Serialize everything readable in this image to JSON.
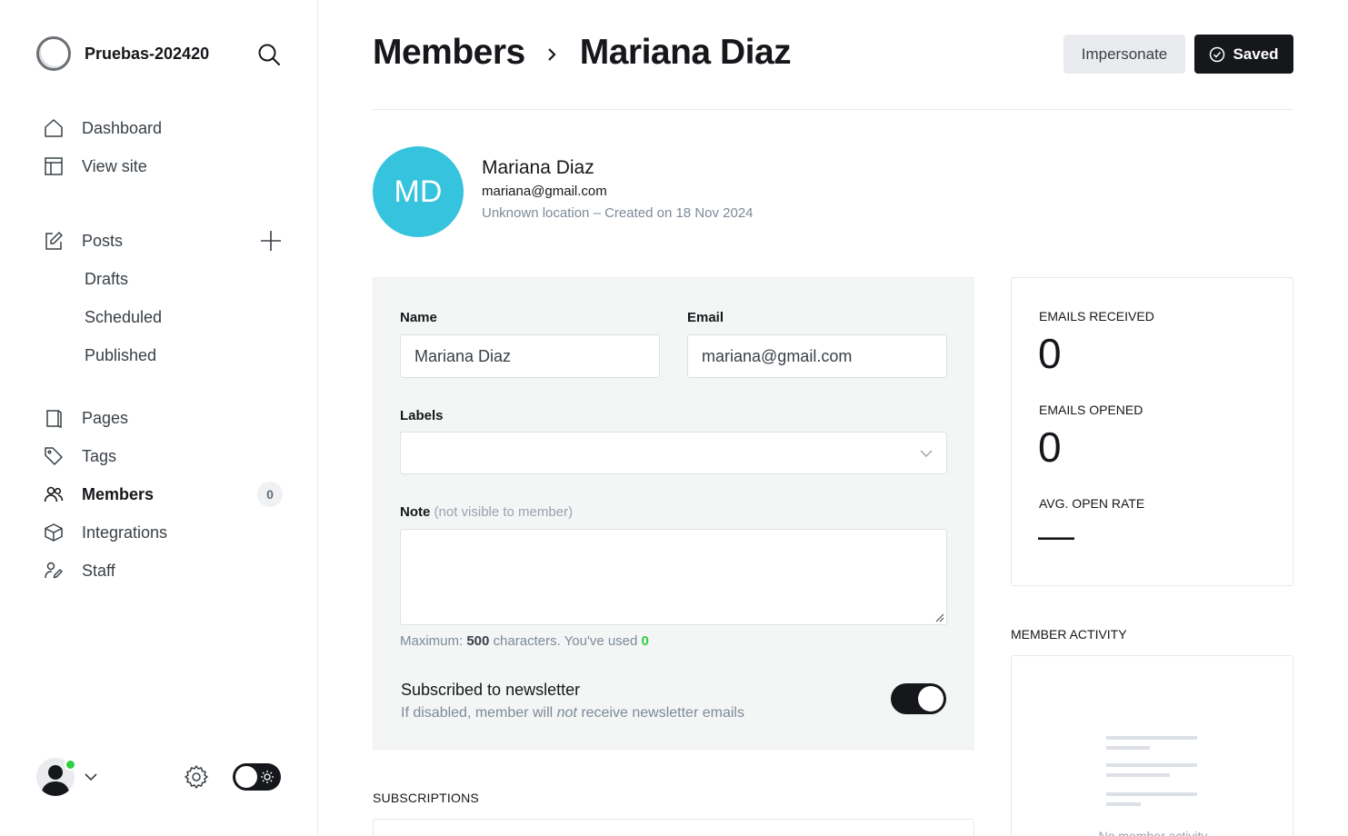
{
  "sidebar": {
    "site_name": "Pruebas-202420",
    "nav": [
      {
        "label": "Dashboard"
      },
      {
        "label": "View site"
      },
      {
        "label": "Posts"
      },
      {
        "label": "Drafts"
      },
      {
        "label": "Scheduled"
      },
      {
        "label": "Published"
      },
      {
        "label": "Pages"
      },
      {
        "label": "Tags"
      },
      {
        "label": "Members",
        "count": "0"
      },
      {
        "label": "Integrations"
      },
      {
        "label": "Staff"
      }
    ]
  },
  "header": {
    "crumb_parent": "Members",
    "crumb_current": "Mariana Diaz",
    "impersonate_label": "Impersonate",
    "saved_label": "Saved"
  },
  "member": {
    "initials": "MD",
    "name": "Mariana Diaz",
    "email": "mariana@gmail.com",
    "meta": "Unknown location – Created on 18 Nov 2024",
    "avatar_color": "#36c3dd"
  },
  "form": {
    "name_label": "Name",
    "name_value": "Mariana Diaz",
    "email_label": "Email",
    "email_value": "mariana@gmail.com",
    "labels_label": "Labels",
    "note_label": "Note",
    "note_muted": "(not visible to member)",
    "hint_prefix": "Maximum:",
    "hint_max": "500",
    "hint_middle": "characters. You've used",
    "hint_used": "0",
    "newsletter_title": "Subscribed to newsletter",
    "newsletter_desc_before": "If disabled, member will",
    "newsletter_desc_em": "not",
    "newsletter_desc_after": "receive newsletter emails",
    "newsletter_enabled": true
  },
  "subscriptions": {
    "heading": "SUBSCRIPTIONS"
  },
  "stats": {
    "received_label": "EMAILS RECEIVED",
    "received_value": "0",
    "opened_label": "EMAILS OPENED",
    "opened_value": "0",
    "rate_label": "AVG. OPEN RATE",
    "rate_value": "—"
  },
  "activity": {
    "heading": "MEMBER ACTIVITY",
    "empty_text": "No member activity"
  },
  "icons": {
    "search": "search-icon",
    "dashboard": "house-icon",
    "view_site": "layout-icon",
    "posts": "pencil-square-icon",
    "add": "plus-icon",
    "pages": "book-icon",
    "tags": "tag-icon",
    "members": "users-icon",
    "integrations": "cube-icon",
    "staff": "staff-icon",
    "settings": "gear-icon",
    "theme": "sun-icon",
    "saved": "check-circle-icon"
  },
  "colors": {
    "accent": "#15171a",
    "success": "#30cf43",
    "avatar": "#36c3dd"
  }
}
